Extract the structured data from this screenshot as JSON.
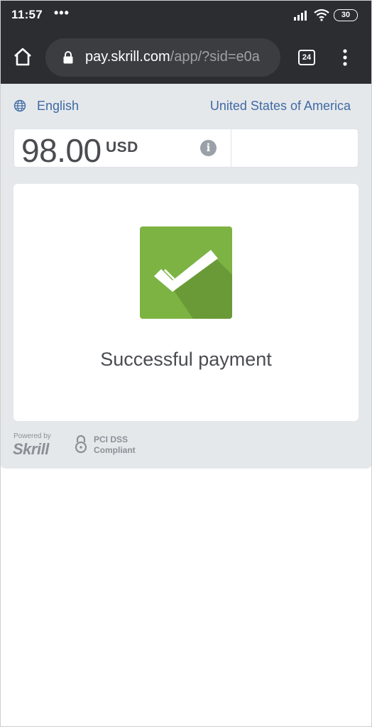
{
  "status_bar": {
    "time": "11:57",
    "dots": "•••",
    "battery": "30"
  },
  "browser": {
    "url_host": "pay.skrill.com",
    "url_path": "/app/?sid=e0a",
    "tabs_count": "24"
  },
  "header": {
    "language": "English",
    "country": "United States of America"
  },
  "amount": {
    "value": "98.00",
    "currency": "USD",
    "info_glyph": "i"
  },
  "result": {
    "message": "Successful payment",
    "icon_color": "#7cb342"
  },
  "footer": {
    "powered_by": "Powered by",
    "brand": "Skrill",
    "pci_line1": "PCI DSS",
    "pci_line2": "Compliant"
  }
}
